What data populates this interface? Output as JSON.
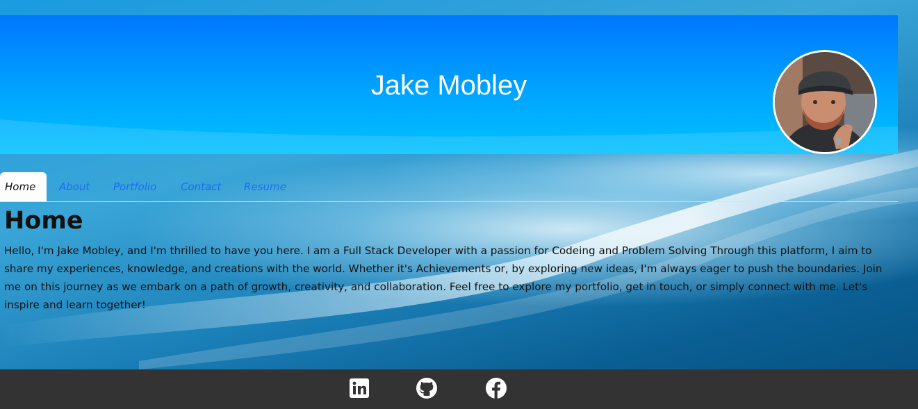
{
  "header": {
    "site_title": "Jake Mobley"
  },
  "nav": {
    "tabs": [
      {
        "label": "Home",
        "active": true
      },
      {
        "label": "About",
        "active": false
      },
      {
        "label": "Portfolio",
        "active": false
      },
      {
        "label": "Contact",
        "active": false
      },
      {
        "label": "Resume",
        "active": false
      }
    ]
  },
  "main": {
    "heading": "Home",
    "intro": "Hello, I'm Jake Mobley, and I'm thrilled to have you here. I am a Full Stack Developer with a passion for Codeing and Problem Solving Through this platform, I aim to share my experiences, knowledge, and creations with the world. Whether it's Achievements or, by exploring new ideas, I'm always eager to push the boundaries. Join me on this journey as we embark on a path of growth, creativity, and collaboration. Feel free to explore my portfolio, get in touch, or simply connect with me. Let's inspire and learn together!"
  },
  "footer": {
    "social_icons": [
      "linkedin-icon",
      "github-icon",
      "facebook-icon"
    ]
  },
  "colors": {
    "header_top": "#0077ff",
    "header_bottom": "#00c2ff",
    "nav_link": "#1d6cf2",
    "footer_bg": "#333333"
  }
}
